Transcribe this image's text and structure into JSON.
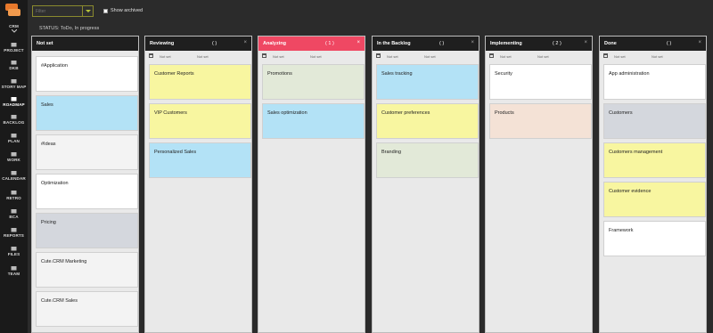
{
  "nav": {
    "app": "CRM",
    "items": [
      "PROJECT",
      "DKB",
      "STORY MAP",
      "ROADMAP",
      "BACKLOG",
      "PLAN",
      "WORK",
      "CALENDAR",
      "RETRO",
      "BCA",
      "REPORTS",
      "FILES",
      "TEAM"
    ],
    "active": "ROADMAP"
  },
  "toolbar": {
    "filter_placeholder": "Filter",
    "show_archived_label": "Show archived",
    "status_text": "STATUS: ToDo, In progress"
  },
  "columns": [
    {
      "title": "Not set",
      "count": "",
      "show_dates": false,
      "cards": [
        {
          "text": "#Application",
          "color": "white"
        },
        {
          "text": "Sales",
          "color": "blue"
        },
        {
          "text": "#Ideas",
          "color": "offwhite"
        },
        {
          "text": "Optimization",
          "color": "white"
        },
        {
          "text": "Pricing",
          "color": "grey"
        },
        {
          "text": "Cute.CRM Marketing",
          "color": "offwhite"
        },
        {
          "text": "Cute.CRM Sales",
          "color": "offwhite"
        }
      ]
    },
    {
      "title": "Reviewing",
      "count": "(    )",
      "show_dates": true,
      "date_from": "Not set",
      "date_to": "Not set",
      "cards": [
        {
          "text": "Customer Reports",
          "color": "yellow"
        },
        {
          "text": "VIP Customers",
          "color": "yellow"
        },
        {
          "text": "Personalized Sales",
          "color": "blue"
        }
      ]
    },
    {
      "title": "Analyzing",
      "count": "(  1  )",
      "show_dates": true,
      "date_from": "Not set",
      "date_to": "Not set",
      "cards": [
        {
          "text": "Promotions",
          "color": "green"
        },
        {
          "text": "Sales optimization",
          "color": "blue"
        }
      ]
    },
    {
      "title": "In the Backlog",
      "count": "(    )",
      "show_dates": true,
      "date_from": "Not set",
      "date_to": "Not set",
      "cards": [
        {
          "text": "Sales tracking",
          "color": "blue"
        },
        {
          "text": "Customer preferences",
          "color": "yellow"
        },
        {
          "text": "Branding",
          "color": "green"
        }
      ]
    },
    {
      "title": "Implementing",
      "count": "(  2  )",
      "show_dates": true,
      "date_from": "Not set",
      "date_to": "Not set",
      "cards": [
        {
          "text": "Security",
          "color": "white"
        },
        {
          "text": "Products",
          "color": "peach"
        }
      ]
    },
    {
      "title": "Done",
      "count": "(    )",
      "show_dates": true,
      "date_from": "Not set",
      "date_to": "Not set",
      "cards": [
        {
          "text": "App administration",
          "color": "white"
        },
        {
          "text": "Customers",
          "color": "grey"
        },
        {
          "text": "Customers management",
          "color": "yellow"
        },
        {
          "text": "Customer evidence",
          "color": "yellow"
        },
        {
          "text": "Framework",
          "color": "white"
        }
      ]
    }
  ],
  "colors": {
    "accent": "#ef4863",
    "logo": "#e8792c",
    "header_dark": "#1f1f1f",
    "card_yellow": "#f8f6a0",
    "card_blue": "#b3e2f6",
    "card_green": "#e2e9d8",
    "card_grey": "#d4d7dd",
    "card_peach": "#f4e2d6"
  }
}
